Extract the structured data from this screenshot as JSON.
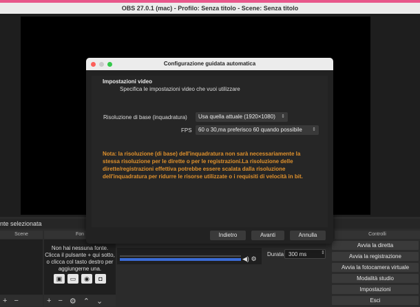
{
  "window": {
    "title": "OBS 27.0.1 (mac) - Profilo: Senza titolo - Scene: Senza titolo"
  },
  "dialog": {
    "title": "Configurazione guidata automatica",
    "heading": "Impostazioni video",
    "subheading": "Specifica le impostazioni video che vuoi utilizzare",
    "resolution_label": "Risoluzione di base (inquadratura)",
    "resolution_value": "Usa quella attuale (1920×1080)",
    "fps_label": "FPS",
    "fps_value": "60 o 30,ma preferisco 60 quando possibile",
    "note": "Nota: la risoluzione (di base) dell'inquadratura non sarà necessariamente la stessa risoluzione per le dirette o per le registrazioni.La risoluzione delle dirette/registrazioni effettiva potrebbe essere scalata dalla risoluzione dell'inquadratura per ridurre le risorse utilizzate o i requisiti di velocità in bit.",
    "back_label": "Indietro",
    "next_label": "Avanti",
    "cancel_label": "Annulla",
    "note_color": "#e0912c"
  },
  "dock": {
    "no_selection": "nte selezionata",
    "scenes_header": "Scene",
    "sources_header": "Fon",
    "controls_header": "Controlli",
    "no_sources_text": "Non hai nessuna fonte. Clicca il pulsante + qui sotto, o clicca col tasto destro per aggiungerne una.",
    "duration_label": "Durata",
    "duration_value": "300 ms"
  },
  "controls": [
    "Avvia la diretta",
    "Avvia la registrazione",
    "Avvia la fotocamera virtuale",
    "Modalità studio",
    "Impostazioni",
    "Esci"
  ]
}
